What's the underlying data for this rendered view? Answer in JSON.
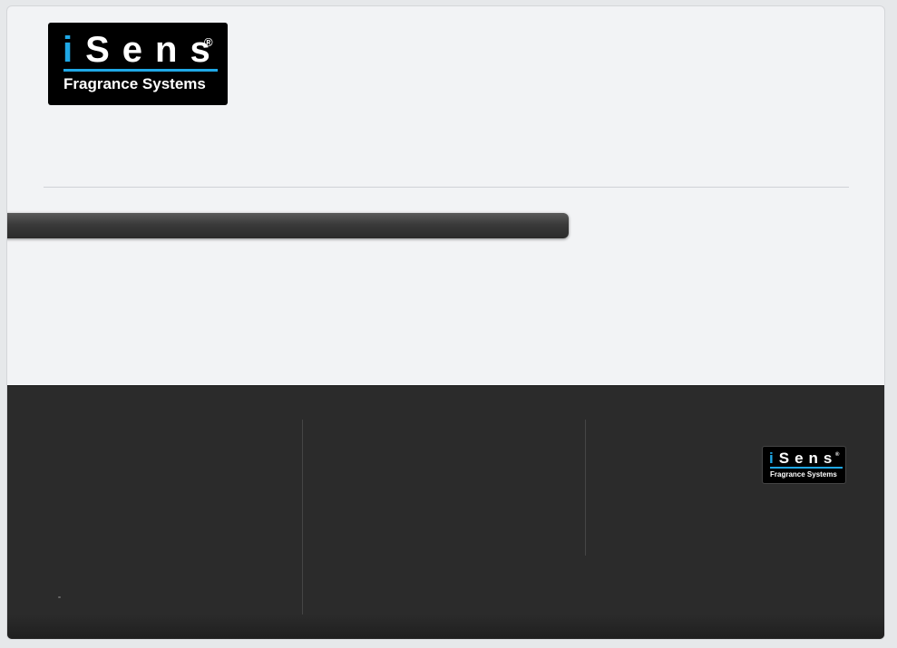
{
  "header": {
    "logo": {
      "wordmark": "iSens",
      "wordmark_i": "i",
      "wordmark_rest": "Sens",
      "registered": "®",
      "tagline": "Fragrance Systems",
      "colors": {
        "background": "#000000",
        "accent": "#1fa8e6",
        "text": "#ffffff"
      }
    }
  },
  "footer": {
    "logo": {
      "wordmark_i": "i",
      "wordmark_rest": "Sens",
      "registered": "®",
      "tagline": "Fragrance Systems"
    },
    "colors": {
      "background": "#2b2b2b"
    }
  },
  "nav_bar": {
    "color": "#333333"
  },
  "page": {
    "background": "#f2f3f5"
  }
}
